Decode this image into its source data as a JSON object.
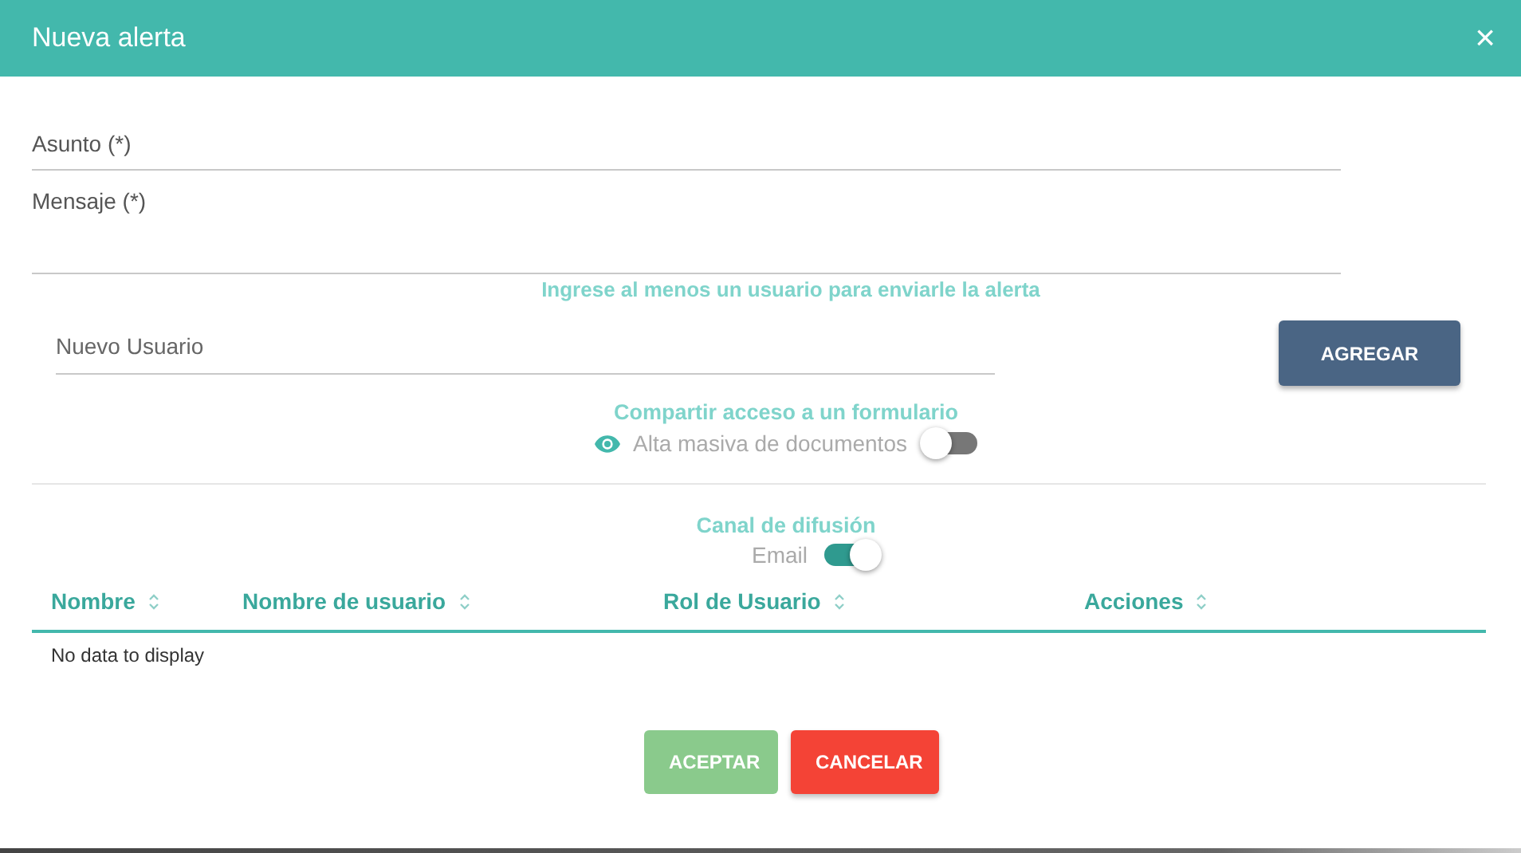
{
  "dialog": {
    "title": "Nueva alerta",
    "close": "×"
  },
  "fields": [
    {
      "kind": "single",
      "label": "Asunto (*)"
    },
    {
      "kind": "multi",
      "label": "Mensaje (*)"
    }
  ],
  "users_hint": "Ingrese al menos un usuario para enviarle la alerta",
  "new_user": {
    "placeholder": "Nuevo Usuario",
    "button": "AGREGAR"
  },
  "share": {
    "title": "Compartir acceso a un formulario",
    "label": "Alta masiva de documentos",
    "on": false
  },
  "channel": {
    "title": "Canal de difusión",
    "label": "Email",
    "on": true
  },
  "table": {
    "columns": [
      "Nombre",
      "Nombre de usuario",
      "Rol de Usuario",
      "Acciones"
    ],
    "empty": "No data to display"
  },
  "buttons": [
    {
      "label": "ACEPTAR",
      "kind": "accept",
      "disabled": true
    },
    {
      "label": "CANCELAR",
      "kind": "cancel",
      "disabled": false
    }
  ]
}
